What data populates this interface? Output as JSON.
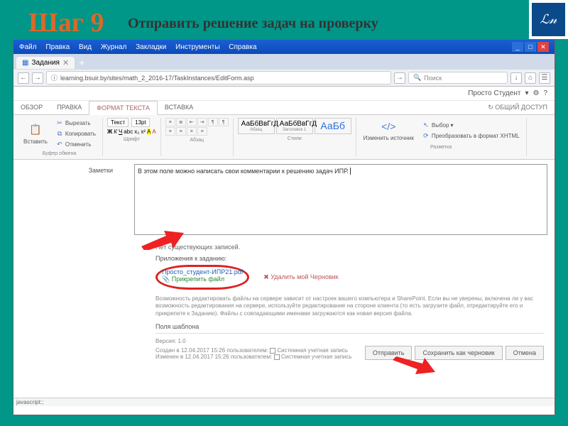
{
  "slide": {
    "title": "Шаг 9",
    "subtitle": "Отправить решение задач на проверку"
  },
  "browser": {
    "menus": [
      "Файл",
      "Правка",
      "Вид",
      "Журнал",
      "Закладки",
      "Инструменты",
      "Справка"
    ],
    "tab_title": "Задания",
    "url": "learning.bsuir.by/sites/math_2_2016-17/TaskInstances/EditForm.asp",
    "search_placeholder": "Поиск",
    "statusbar": "javascript:;"
  },
  "sp": {
    "user": "Просто Студент",
    "tabs": {
      "overview": "ОБЗОР",
      "edit": "ПРАВКА",
      "format": "ФОРМАТ ТЕКСТА",
      "insert": "ВСТАВКА"
    },
    "share": "ОБЩИЙ ДОСТУП"
  },
  "ribbon": {
    "paste": "Вставить",
    "cut": "Вырезать",
    "copy": "Копировать",
    "undo": "Отменить",
    "clipboard": "Буфер обмена",
    "font_sel": "Текст",
    "size_sel": "13pt",
    "font_title": "Шрифт",
    "para_title": "Абзац",
    "style_prev": "АаБбВвГгД",
    "style1": "Абзац",
    "style2": "Заголовок 1",
    "style_big": "АаБб",
    "styles_title": "Стили",
    "editsrc": "Изменить источник",
    "markup_sel": "Выбор",
    "markup_conv": "Преобразовать в формат XHTML",
    "markup_title": "Разметка"
  },
  "form": {
    "notes_label": "Заметки",
    "comment_text": "В этом поле можно написать свои комментарии к решению задач ИПР.",
    "no_records": "Нет существующих записей.",
    "attach_title": "Приложения к заданию:",
    "attach_file": "Просто_студент-ИПР21.pdf",
    "attach_add": "Прикрепить файл",
    "delete_draft": "Удалить мой Черновик",
    "help": "Возможность редактировать файлы на сервере зависит от настроек вашего компьютера и SharePoint. Если вы не уверены, включена ли у вас возможность редактирования на сервере, используйте редактирование на стороне клиента (то есть загрузите файл, отредактируйте его и прикрепите к Заданию). Файлы с совпадающими именами загружаются как новая версия файла.",
    "fields_title": "Поля шаблона",
    "version": "Версия: 1.0",
    "created": "Создан в 12.04.2017 15:26 пользователем:",
    "modified": "Изменен в 12.04.2017 15:26 пользователем:",
    "sys_account": "Системная учетная запись",
    "btn_send": "Отправить",
    "btn_draft": "Сохранить как черновик",
    "btn_cancel": "Отмена"
  }
}
